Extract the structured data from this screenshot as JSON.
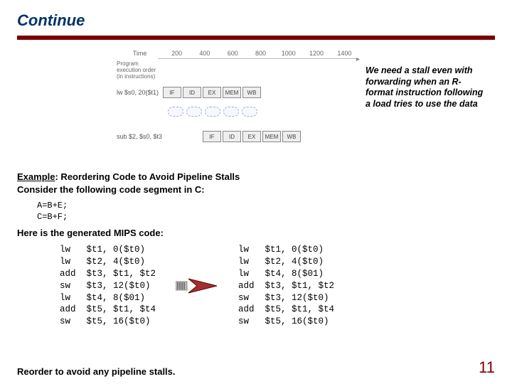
{
  "title": "Continue",
  "diagram": {
    "exec_order": "Program execution order (in instructions)",
    "time_label": "Time",
    "ticks": [
      "200",
      "400",
      "600",
      "800",
      "1000",
      "1200",
      "1400"
    ],
    "row1_label": "lw $s0, 20($t1)",
    "row2_label": "sub $2, $s0, $t3",
    "stages": [
      "IF",
      "ID",
      "EX",
      "MEM",
      "WB"
    ],
    "bubble_label": "bubble"
  },
  "callout": "We need a stall even with forwarding when an R-format instruction following a load tries to use the data",
  "example_label": "Example",
  "example_rest": ": Reordering Code to Avoid Pipeline Stalls",
  "consider": "Consider the following code segment in C:",
  "c1": "A=B+E;",
  "c2": "C=B+F;",
  "here_is": "Here is the generated MIPS code:",
  "mips_left": "lw   $t1, 0($t0)\nlw   $t2, 4($t0)\nadd  $t3, $t1, $t2\nsw   $t3, 12($t0)\nlw   $t4, 8($01)\nadd  $t5, $t1, $t4\nsw   $t5, 16($t0)",
  "mips_right": "lw   $t1, 0($t0)\nlw   $t2, 4($t0)\nlw   $t4, 8($01)\nadd  $t3, $t1, $t2\nsw   $t3, 12($t0)\nadd  $t5, $t1, $t4\nsw   $t5, 16($t0)",
  "reorder_note": "Reorder to avoid any pipeline stalls.",
  "page_number": "11"
}
